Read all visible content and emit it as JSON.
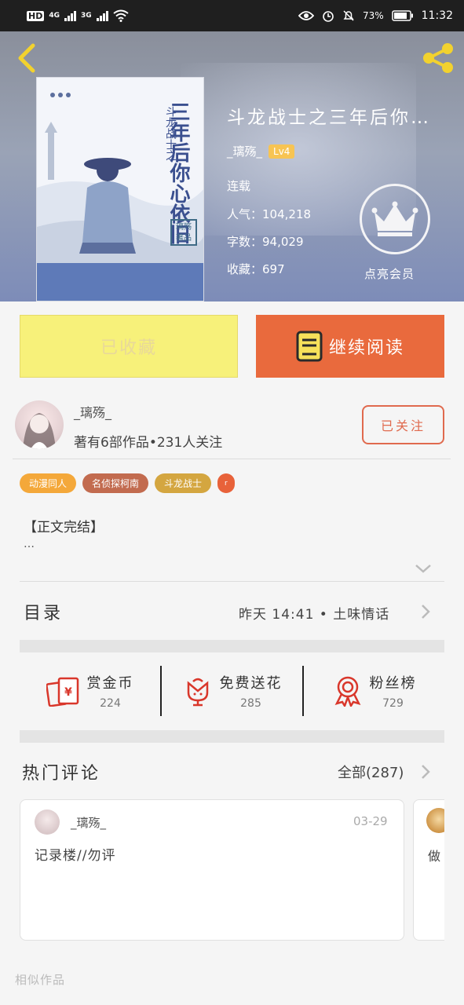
{
  "status_bar": {
    "hd": "HD",
    "net1": "4G",
    "net2": "3G",
    "battery": "73%",
    "time": "11:32"
  },
  "book": {
    "title": "斗龙战士之三年后你…",
    "cover_title": "三年后你心依旧",
    "cover_subtitle": "斗龙战士之",
    "cover_badge": "璃殇 著品",
    "author": "_璃殇_",
    "level": "Lv4",
    "status": "连载",
    "popularity": "人气：104,218",
    "word_count": "字数：94,029",
    "favorites": "收藏：697"
  },
  "vip": {
    "label": "点亮会员"
  },
  "actions": {
    "collect_label": "已收藏",
    "read_label": "继续阅读"
  },
  "author_card": {
    "name": "_璃殇_",
    "summary": "著有6部作品•231人关注",
    "follow_label": "已关注"
  },
  "tags": [
    {
      "label": "动漫同人",
      "color": "#f4a83a"
    },
    {
      "label": "名侦探柯南",
      "color": "#c26b4f"
    },
    {
      "label": "斗龙战士",
      "color": "#d4a640"
    },
    {
      "label": "r",
      "color": "#e8623a"
    }
  ],
  "intro": {
    "title": "【正文完结】",
    "body": "…"
  },
  "toc": {
    "label": "目录",
    "latest": "昨天 14:41 • 土味情话"
  },
  "stats": [
    {
      "label": "赏金币",
      "value": "224",
      "icon": "red-envelope-icon"
    },
    {
      "label": "免费送花",
      "value": "285",
      "icon": "flower-icon"
    },
    {
      "label": "粉丝榜",
      "value": "729",
      "icon": "medal-icon"
    }
  ],
  "comments": {
    "label": "热门评论",
    "all_label": "全部(287)",
    "items": [
      {
        "user": "_璃殇_",
        "date": "03-29",
        "text": "记录楼//勿评"
      },
      {
        "text": "做"
      }
    ]
  },
  "similar": {
    "label": "相似作品"
  },
  "colors": {
    "accent_orange": "#e96a3d",
    "collect_yellow": "#f7f17a",
    "hero_blue": "#7d8cb8"
  }
}
